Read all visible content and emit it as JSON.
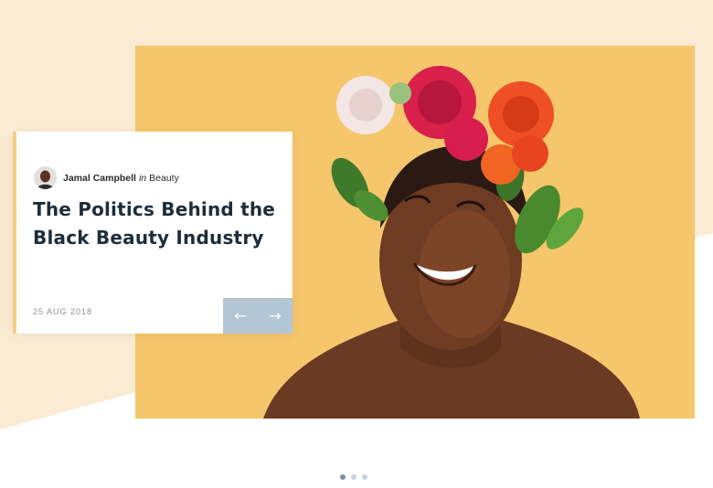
{
  "article": {
    "author": "Jamal Campbell",
    "in_word": "in",
    "category": "Beauty",
    "title_line1": "The Politics Behind the",
    "title_line2": "Black Beauty Industry",
    "date": "25 AUG 2018"
  },
  "navigation": {
    "prev_icon": "←",
    "next_icon": "→"
  },
  "pagination": {
    "total": 3,
    "active_index": 0
  },
  "colors": {
    "background_shape": "#faebd2",
    "hero_background": "#f5c66c",
    "card_accent": "#f2cf86",
    "nav_button": "#b3c6d6",
    "title_text": "#1f2d3a"
  }
}
